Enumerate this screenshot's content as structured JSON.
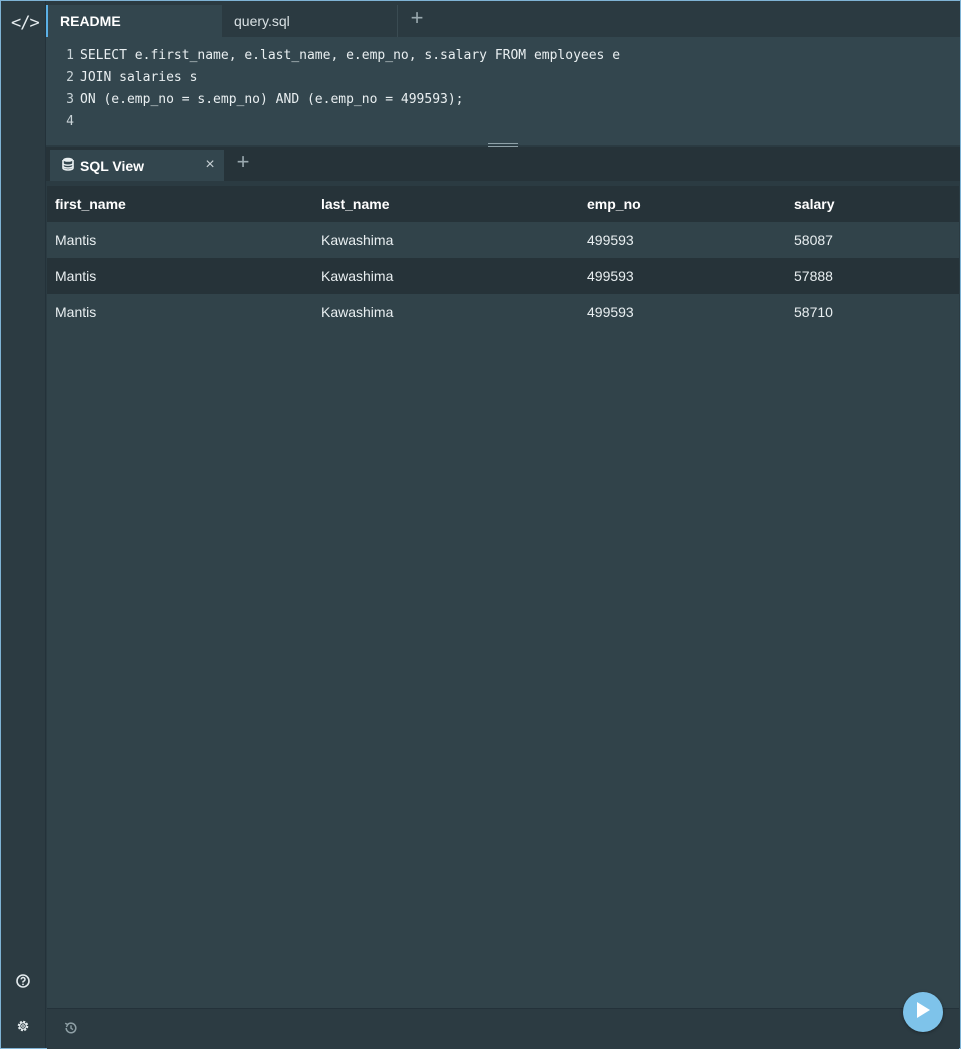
{
  "app": {
    "logo_text": "</>"
  },
  "editor": {
    "tabs": [
      {
        "label": "README",
        "active": true
      },
      {
        "label": "query.sql",
        "active": false
      }
    ],
    "add_tab_label": "+",
    "code_lines": [
      {
        "num": "1",
        "text": "SELECT e.first_name, e.last_name, e.emp_no, s.salary FROM employees e"
      },
      {
        "num": "2",
        "text": "JOIN salaries s"
      },
      {
        "num": "3",
        "text": "ON (e.emp_no = s.emp_no) AND (e.emp_no = 499593);"
      },
      {
        "num": "4",
        "text": ""
      }
    ]
  },
  "results_panel": {
    "tab_label": "SQL View",
    "close_label": "×",
    "add_tab_label": "+",
    "columns": [
      "first_name",
      "last_name",
      "emp_no",
      "salary"
    ],
    "rows": [
      [
        "Mantis",
        "Kawashima",
        "499593",
        "58087"
      ],
      [
        "Mantis",
        "Kawashima",
        "499593",
        "57888"
      ],
      [
        "Mantis",
        "Kawashima",
        "499593",
        "58710"
      ]
    ]
  },
  "icons": {
    "logo": "code-brackets-icon",
    "database": "database-icon",
    "help": "help-circle-icon",
    "settings": "gear-icon",
    "history": "history-icon",
    "run": "play-icon"
  },
  "colors": {
    "accent": "#5bb0e6",
    "run_button": "#7ec3ea",
    "background": "#2b3b42"
  }
}
